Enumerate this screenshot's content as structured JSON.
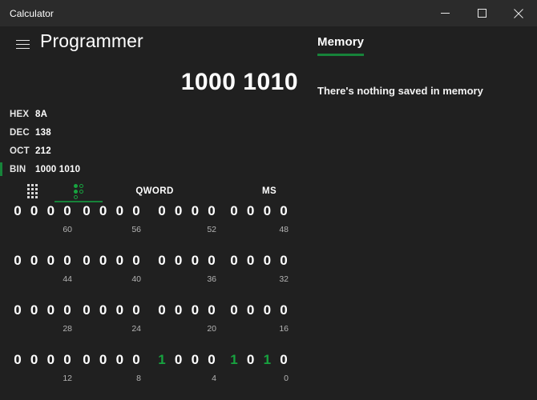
{
  "window": {
    "title": "Calculator",
    "controls": [
      {
        "name": "minimize",
        "glyph": "minimize-icon"
      },
      {
        "name": "maximize",
        "glyph": "maximize-icon"
      },
      {
        "name": "close",
        "glyph": "close-icon"
      }
    ]
  },
  "header": {
    "menu_icon": "hamburger-menu-icon",
    "mode_title": "Programmer"
  },
  "memory": {
    "tab_label": "Memory",
    "empty_message": "There's nothing saved in memory",
    "accent_color": "#17843a"
  },
  "display": {
    "value": "1000 1010"
  },
  "bases": [
    {
      "name": "HEX",
      "value": "8A",
      "active": false
    },
    {
      "name": "DEC",
      "value": "138",
      "active": false
    },
    {
      "name": "OCT",
      "value": "212",
      "active": false
    },
    {
      "name": "BIN",
      "value": "1000 1010",
      "active": true
    }
  ],
  "bit_toolbar": {
    "keypad_icon": "keypad-grid-icon",
    "bitflip_icon": "bit-toggle-icon",
    "bitflip_active": true,
    "word_size_label": "QWORD",
    "memory_store_label": "MS"
  },
  "bit_grid": {
    "rows": [
      {
        "groups": [
          {
            "bits": [
              "0",
              "0",
              "0",
              "0"
            ],
            "on": [
              false,
              false,
              false,
              false
            ],
            "label": "60"
          },
          {
            "bits": [
              "0",
              "0",
              "0",
              "0"
            ],
            "on": [
              false,
              false,
              false,
              false
            ],
            "label": "56"
          },
          {
            "bits": [
              "0",
              "0",
              "0",
              "0"
            ],
            "on": [
              false,
              false,
              false,
              false
            ],
            "label": "52"
          },
          {
            "bits": [
              "0",
              "0",
              "0",
              "0"
            ],
            "on": [
              false,
              false,
              false,
              false
            ],
            "label": "48"
          }
        ]
      },
      {
        "groups": [
          {
            "bits": [
              "0",
              "0",
              "0",
              "0"
            ],
            "on": [
              false,
              false,
              false,
              false
            ],
            "label": "44"
          },
          {
            "bits": [
              "0",
              "0",
              "0",
              "0"
            ],
            "on": [
              false,
              false,
              false,
              false
            ],
            "label": "40"
          },
          {
            "bits": [
              "0",
              "0",
              "0",
              "0"
            ],
            "on": [
              false,
              false,
              false,
              false
            ],
            "label": "36"
          },
          {
            "bits": [
              "0",
              "0",
              "0",
              "0"
            ],
            "on": [
              false,
              false,
              false,
              false
            ],
            "label": "32"
          }
        ]
      },
      {
        "groups": [
          {
            "bits": [
              "0",
              "0",
              "0",
              "0"
            ],
            "on": [
              false,
              false,
              false,
              false
            ],
            "label": "28"
          },
          {
            "bits": [
              "0",
              "0",
              "0",
              "0"
            ],
            "on": [
              false,
              false,
              false,
              false
            ],
            "label": "24"
          },
          {
            "bits": [
              "0",
              "0",
              "0",
              "0"
            ],
            "on": [
              false,
              false,
              false,
              false
            ],
            "label": "20"
          },
          {
            "bits": [
              "0",
              "0",
              "0",
              "0"
            ],
            "on": [
              false,
              false,
              false,
              false
            ],
            "label": "16"
          }
        ]
      },
      {
        "groups": [
          {
            "bits": [
              "0",
              "0",
              "0",
              "0"
            ],
            "on": [
              false,
              false,
              false,
              false
            ],
            "label": "12"
          },
          {
            "bits": [
              "0",
              "0",
              "0",
              "0"
            ],
            "on": [
              false,
              false,
              false,
              false
            ],
            "label": "8"
          },
          {
            "bits": [
              "1",
              "0",
              "0",
              "0"
            ],
            "on": [
              true,
              false,
              false,
              false
            ],
            "label": "4"
          },
          {
            "bits": [
              "1",
              "0",
              "1",
              "0"
            ],
            "on": [
              true,
              false,
              true,
              false
            ],
            "label": "0"
          }
        ]
      }
    ]
  }
}
